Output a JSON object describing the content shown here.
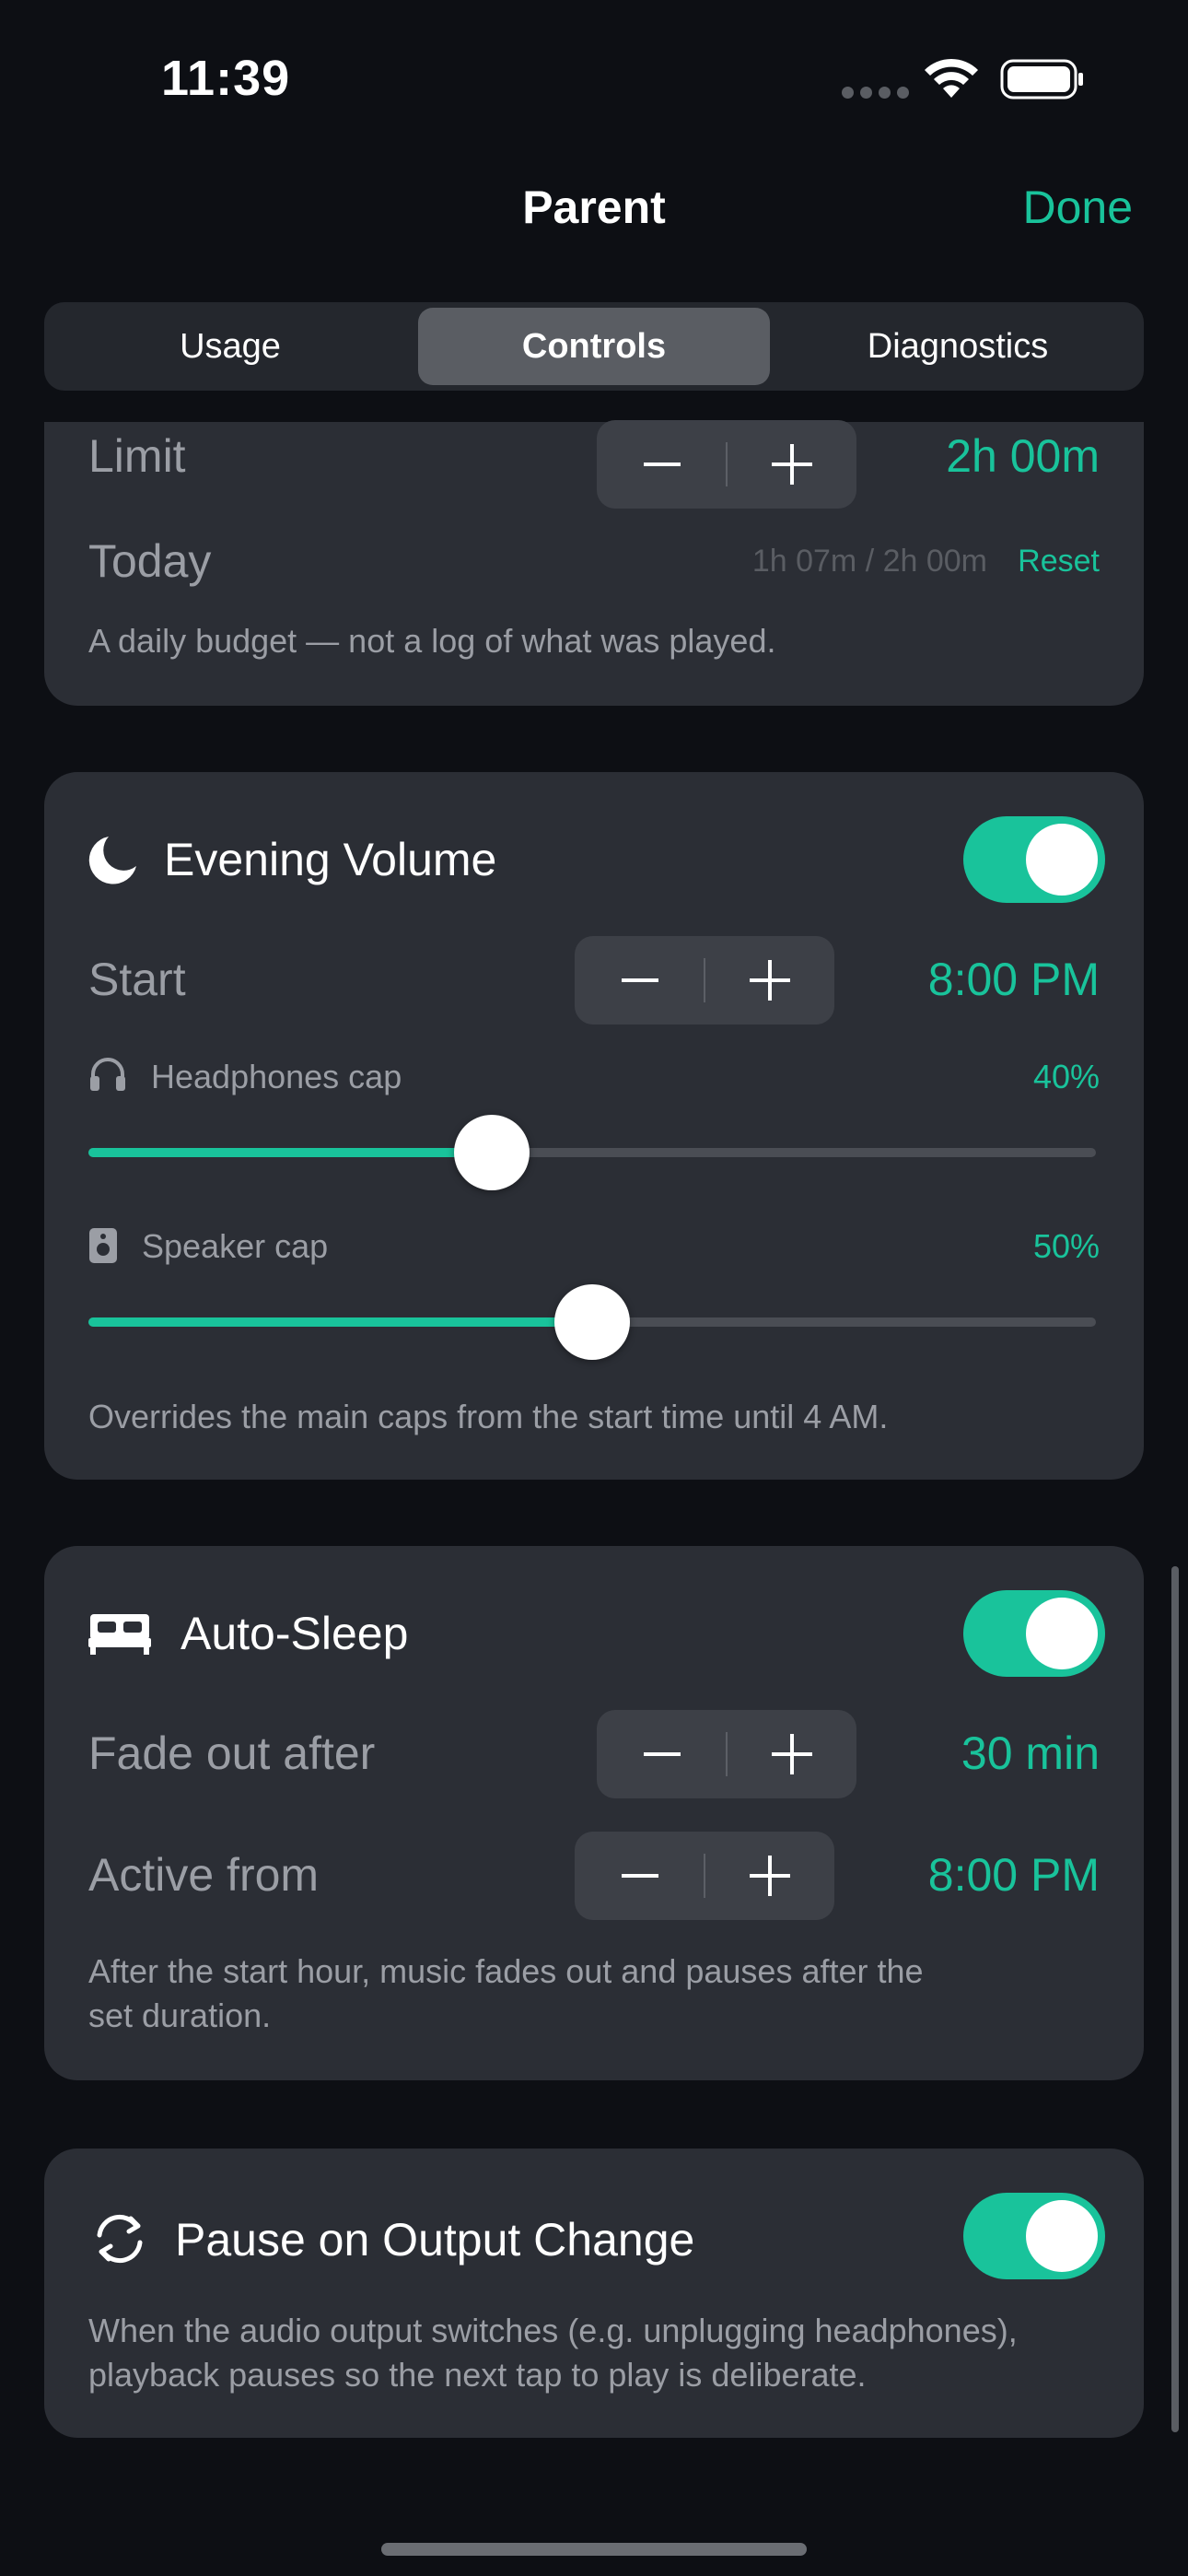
{
  "status": {
    "time": "11:39"
  },
  "nav": {
    "title": "Parent",
    "done_label": "Done"
  },
  "tabs": [
    {
      "label": "Usage",
      "active": false
    },
    {
      "label": "Controls",
      "active": true
    },
    {
      "label": "Diagnostics",
      "active": false
    }
  ],
  "budget": {
    "limit_label": "Limit",
    "limit_value": "2h 00m",
    "today_label": "Today",
    "today_value": "1h 07m / 2h 00m",
    "reset_label": "Reset",
    "note": "A daily budget — not a log of what was played."
  },
  "evening_volume": {
    "title": "Evening Volume",
    "enabled": true,
    "start_label": "Start",
    "start_value": "8:00 PM",
    "headphones_label": "Headphones cap",
    "headphones_value": "40%",
    "headphones_level": 0.4,
    "speaker_label": "Speaker cap",
    "speaker_value": "50%",
    "speaker_level": 0.5,
    "note": "Overrides the main caps from the start time until 4 AM."
  },
  "auto_sleep": {
    "title": "Auto-Sleep",
    "enabled": true,
    "fade_label": "Fade out after",
    "fade_value": "30 min",
    "active_label": "Active from",
    "active_value": "8:00 PM",
    "note_line1": "After the start hour, music fades out and pauses after the",
    "note_line2": "set duration."
  },
  "pause_output": {
    "title": "Pause on Output Change",
    "enabled": true,
    "note_line1": "When the audio output switches (e.g. unplugging headphones),",
    "note_line2": "playback pauses so the next tap to play is deliberate."
  },
  "colors": {
    "accent": "#19c39b",
    "card": "#2b2e35",
    "background": "#0d0f14"
  }
}
